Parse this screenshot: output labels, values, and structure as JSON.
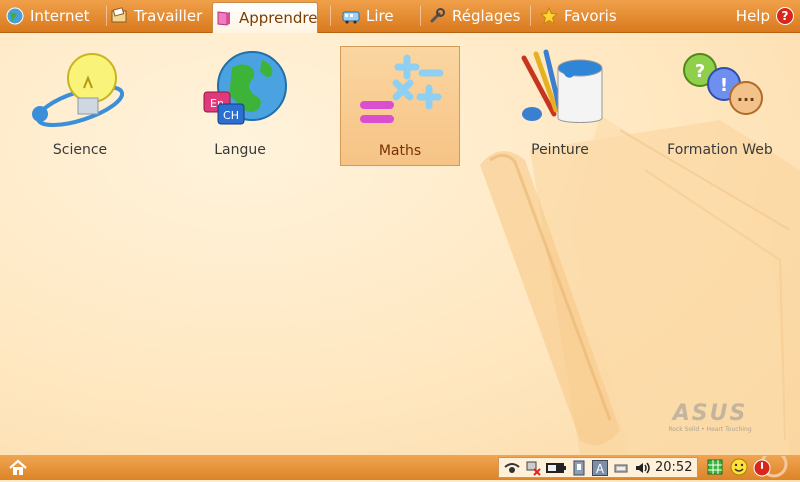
{
  "tabs": [
    {
      "label": "Internet",
      "icon": "globe-icon"
    },
    {
      "label": "Travailler",
      "icon": "folder-icon"
    },
    {
      "label": "Apprendre",
      "icon": "book-icon",
      "active": true
    },
    {
      "label": "Lire",
      "icon": "bus-icon"
    },
    {
      "label": "Réglages",
      "icon": "wrench-icon"
    },
    {
      "label": "Favoris",
      "icon": "star-icon"
    }
  ],
  "help": {
    "label": "Help",
    "glyph": "?"
  },
  "apps": [
    {
      "label": "Science",
      "icon": "lightbulb-icon"
    },
    {
      "label": "Langue",
      "icon": "language-globe-icon",
      "tiles": [
        "En",
        "CH"
      ]
    },
    {
      "label": "Maths",
      "icon": "math-symbols-icon",
      "selected": true
    },
    {
      "label": "Peinture",
      "icon": "paint-bucket-icon"
    },
    {
      "label": "Formation Web",
      "icon": "help-bubbles-icon",
      "bubbles": [
        "?",
        "!",
        "..."
      ]
    }
  ],
  "brand": {
    "word": "ASUS",
    "tagline": "Rock Solid • Heart Touching"
  },
  "tray": {
    "time": "20:52",
    "keyboard_letter": "A"
  },
  "colors": {
    "accent": "#e08a2e",
    "selected_bg": "#f8cb8d",
    "help_red": "#d9261c"
  }
}
